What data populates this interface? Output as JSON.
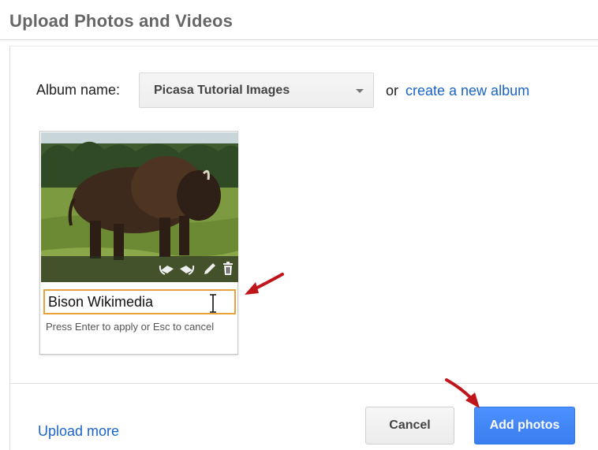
{
  "dialog": {
    "title": "Upload Photos and Videos"
  },
  "album": {
    "label": "Album name:",
    "selected": "Picasa Tutorial Images",
    "or_text": "or",
    "create_link": "create a new album"
  },
  "photo": {
    "image_icon": "bison-photo",
    "toolbar_icons": [
      "rotate-left-icon",
      "rotate-right-icon",
      "pencil-icon",
      "trash-icon"
    ],
    "caption_value": "Bison Wikimedia",
    "caption_hint": "Press Enter to apply or Esc to cancel"
  },
  "footer": {
    "upload_more": "Upload more",
    "cancel_label": "Cancel",
    "add_label": "Add photos"
  },
  "colors": {
    "link": "#1a64c8",
    "primary_button": "#4d90fe",
    "caption_focus_border": "#e8a23c",
    "annotation_arrow": "#c0151a"
  }
}
